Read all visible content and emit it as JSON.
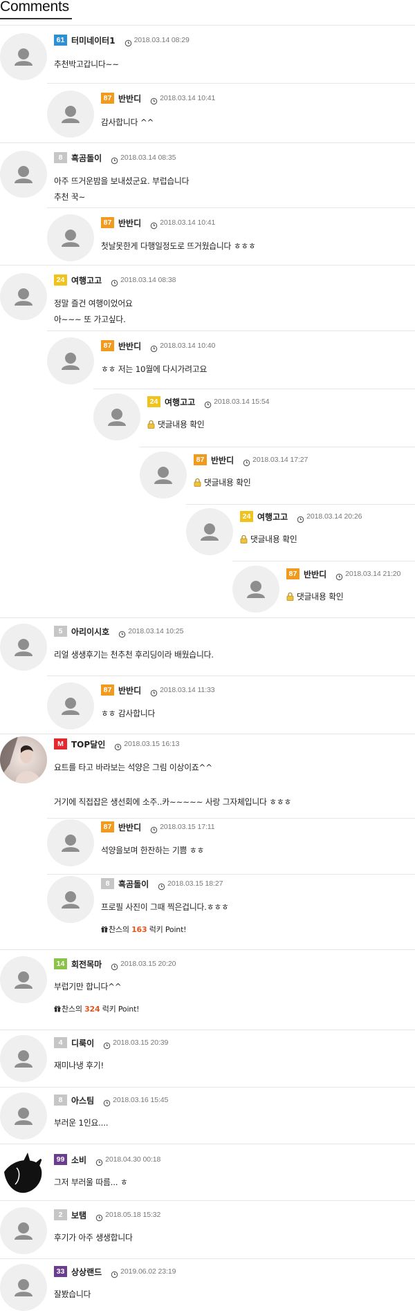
{
  "header": {
    "title": "Comments"
  },
  "colors": {
    "level_blue": "#2d8fd6",
    "level_orange": "#f29a1e",
    "level_gray": "#c6c6c6",
    "level_yellow": "#f1c21b",
    "level_red": "#e5282e",
    "level_green": "#8ac24a",
    "level_purple": "#6a3d90",
    "point_red": "#e8541d",
    "avatar_bg": "#efefef"
  },
  "comments": [
    {
      "level": "61",
      "level_color": "blue",
      "nickname": "터미네이터1",
      "date": "2018.03.14 08:29",
      "lines": [
        "추천박고갑니다~~"
      ],
      "avatar": "default"
    },
    {
      "level": "87",
      "level_color": "orange",
      "nickname": "반반디",
      "date": "2018.03.14 10:41",
      "lines": [
        "감사합니다 ^^"
      ],
      "avatar": "default"
    },
    {
      "level": "8",
      "level_color": "gray",
      "nickname": "흑곰돌이",
      "date": "2018.03.14 08:35",
      "lines": [
        "아주 뜨거운밤을 보내셨군요. 부럽습니다",
        "추천 꾹~"
      ],
      "avatar": "default"
    },
    {
      "level": "87",
      "level_color": "orange",
      "nickname": "반반디",
      "date": "2018.03.14 10:41",
      "lines": [
        "첫날못한게 다행일정도로 뜨거웠습니다 ㅎㅎㅎ"
      ],
      "avatar": "default"
    },
    {
      "level": "24",
      "level_color": "yellow",
      "nickname": "여행고고",
      "date": "2018.03.14 08:38",
      "lines": [
        "정말 즐건 여행이었어요",
        "아~~~   또 가고싶다."
      ],
      "avatar": "default"
    },
    {
      "level": "87",
      "level_color": "orange",
      "nickname": "반반디",
      "date": "2018.03.14 10:40",
      "lines": [
        "ㅎㅎ 저는 10월에 다시가려고요"
      ],
      "avatar": "default"
    },
    {
      "level": "24",
      "level_color": "yellow",
      "nickname": "여행고고",
      "date": "2018.03.14 15:54",
      "lines": [
        "댓글내용 확인"
      ],
      "secret": true,
      "avatar": "default"
    },
    {
      "level": "87",
      "level_color": "orange",
      "nickname": "반반디",
      "date": "2018.03.14 17:27",
      "lines": [
        "댓글내용 확인"
      ],
      "secret": true,
      "avatar": "default"
    },
    {
      "level": "24",
      "level_color": "yellow",
      "nickname": "여행고고",
      "date": "2018.03.14 20:26",
      "lines": [
        "댓글내용 확인"
      ],
      "secret": true,
      "avatar": "default"
    },
    {
      "level": "87",
      "level_color": "orange",
      "nickname": "반반디",
      "date": "2018.03.14 21:20",
      "lines": [
        "댓글내용 확인"
      ],
      "secret": true,
      "avatar": "default"
    },
    {
      "level": "5",
      "level_color": "gray",
      "nickname": "아리이시호",
      "date": "2018.03.14 10:25",
      "lines": [
        "리얼 생생후기는 천추천 후리딩이라 배웠습니다."
      ],
      "avatar": "default"
    },
    {
      "level": "87",
      "level_color": "orange",
      "nickname": "반반디",
      "date": "2018.03.14 11:33",
      "lines": [
        "ㅎㅎ 감사합니다"
      ],
      "avatar": "default"
    },
    {
      "level": "M",
      "level_color": "red",
      "nickname": "TOP달인",
      "date": "2018.03.15 16:13",
      "lines": [
        "요트를 타고 바라보는 석양은 그림 이상이죠^^",
        "",
        "거기에 직접잡은 생선회에 소주..카~~~~~ 사랑 그자체입니다 ㅎㅎㅎ"
      ],
      "avatar": "photo"
    },
    {
      "level": "87",
      "level_color": "orange",
      "nickname": "반반디",
      "date": "2018.03.15 17:11",
      "lines": [
        "석양을보며 한잔하는 기쁨 ㅎㅎ"
      ],
      "avatar": "default"
    },
    {
      "level": "8",
      "level_color": "gray",
      "nickname": "흑곰돌이",
      "date": "2018.03.15 18:27",
      "lines": [
        "프로필 사진이 그때 찍은겁니다.ㅎㅎㅎ"
      ],
      "point": {
        "prefix": "찬스의",
        "number": "163",
        "suffix": "럭키 Point!"
      },
      "avatar": "default"
    },
    {
      "level": "14",
      "level_color": "green",
      "nickname": "회전목마",
      "date": "2018.03.15 20:20",
      "lines": [
        "부럽기만 합니다^^"
      ],
      "point": {
        "prefix": "찬스의",
        "number": "324",
        "suffix": "럭키 Point!"
      },
      "avatar": "default"
    },
    {
      "level": "4",
      "level_color": "gray",
      "nickname": "디룩이",
      "date": "2018.03.15 20:39",
      "lines": [
        "재미나냉 후기!"
      ],
      "avatar": "default"
    },
    {
      "level": "8",
      "level_color": "gray",
      "nickname": "아스팀",
      "date": "2018.03.16 15:45",
      "lines": [
        "부러운 1인요...."
      ],
      "avatar": "default"
    },
    {
      "level": "99",
      "level_color": "purple",
      "nickname": "소비",
      "date": "2018.04.30 00:18",
      "lines": [
        "그저 부러울 따름... ㅎ"
      ],
      "avatar": "dark"
    },
    {
      "level": "2",
      "level_color": "gray",
      "nickname": "보탬",
      "date": "2018.05.18 15:32",
      "lines": [
        "후기가 아주 생생합니다"
      ],
      "avatar": "default"
    },
    {
      "level": "33",
      "level_color": "purple",
      "nickname": "상상랜드",
      "date": "2019.06.02 23:19",
      "lines": [
        "잘봤습니다"
      ],
      "avatar": "default"
    }
  ]
}
